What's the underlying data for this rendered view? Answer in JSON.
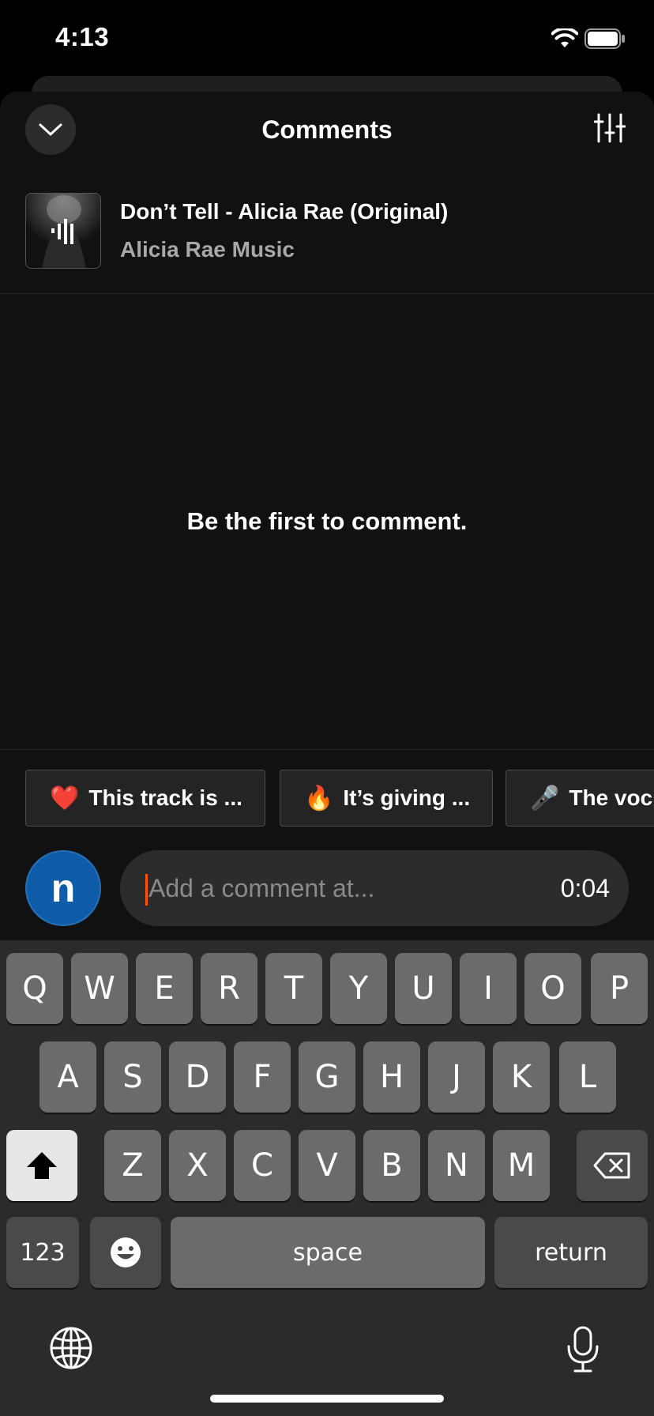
{
  "status_bar": {
    "time": "4:13"
  },
  "header": {
    "title": "Comments"
  },
  "track": {
    "title": "Don’t Tell - Alicia Rae (Original)",
    "artist": "Alicia Rae Music"
  },
  "empty_state": {
    "message": "Be the first to comment."
  },
  "quick_replies": [
    {
      "emoji": "❤️",
      "label": "This track is ..."
    },
    {
      "emoji": "🔥",
      "label": "It’s giving ..."
    },
    {
      "emoji": "🎤",
      "label": "The voc"
    }
  ],
  "composer": {
    "avatar_initial": "n",
    "placeholder": "Add a comment at...",
    "timestamp": "0:04"
  },
  "keyboard": {
    "row1": [
      "Q",
      "W",
      "E",
      "R",
      "T",
      "Y",
      "U",
      "I",
      "O",
      "P"
    ],
    "row2": [
      "A",
      "S",
      "D",
      "F",
      "G",
      "H",
      "J",
      "K",
      "L"
    ],
    "row3": [
      "Z",
      "X",
      "C",
      "V",
      "B",
      "N",
      "M"
    ],
    "numbers_label": "123",
    "space_label": "space",
    "return_label": "return"
  },
  "colors": {
    "accent": "#ff5500",
    "avatar_bg": "#0f5da8",
    "sheet_bg": "#111111"
  },
  "icons": [
    "chevron-down-icon",
    "sliders-icon",
    "wifi-icon",
    "battery-icon",
    "shift-icon",
    "backspace-icon",
    "emoji-icon",
    "globe-icon",
    "microphone-icon"
  ]
}
